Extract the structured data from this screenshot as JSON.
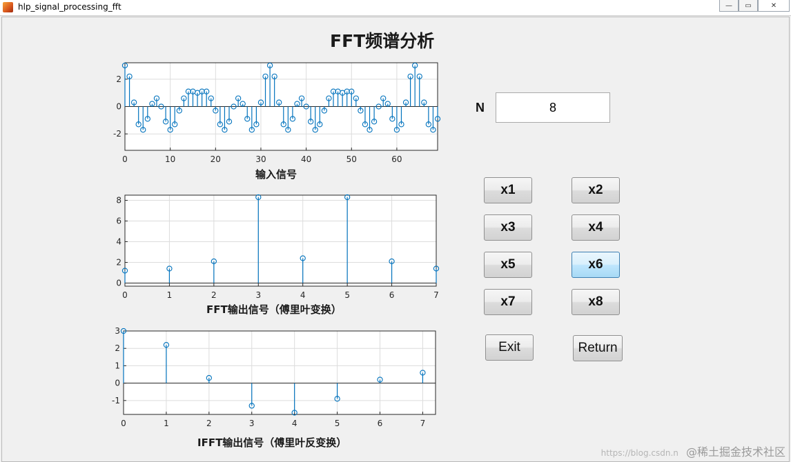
{
  "window": {
    "title": "hlp_signal_processing_fft",
    "controls": {
      "minimize": "—",
      "maximize": "▭",
      "close": "✕"
    }
  },
  "page_title": "FFT频谱分析",
  "n_field": {
    "label": "N",
    "value": "8"
  },
  "buttons": {
    "x1": "x1",
    "x2": "x2",
    "x3": "x3",
    "x4": "x4",
    "x5": "x5",
    "x6": "x6",
    "x7": "x7",
    "x8": "x8",
    "exit": "Exit",
    "return": "Return",
    "active": "x6"
  },
  "colors": {
    "stem": "#0072bd",
    "axes": "#262626",
    "grid": "#dcdcdc"
  },
  "watermark": {
    "url": "https://blog.csdn.n",
    "brand": "@稀土掘金技术社区"
  },
  "chart_data": [
    {
      "type": "stem",
      "caption": "输入信号",
      "xlim": [
        0,
        69
      ],
      "ylim": [
        -3.2,
        3.2
      ],
      "xticks": [
        0,
        10,
        20,
        30,
        40,
        50,
        60
      ],
      "yticks": [
        -2,
        0,
        2
      ],
      "x_start": 0,
      "values": [
        3.0,
        2.2,
        0.3,
        -1.3,
        -1.7,
        -0.9,
        0.2,
        0.6,
        0.0,
        -1.1,
        -1.7,
        -1.3,
        -0.3,
        0.6,
        1.1,
        1.1,
        1.0,
        1.1,
        1.1,
        0.6,
        -0.3,
        -1.3,
        -1.7,
        -1.1,
        0.0,
        0.6,
        0.2,
        -0.9,
        -1.7,
        -1.3,
        0.3,
        2.2,
        3.0,
        2.2,
        0.3,
        -1.3,
        -1.7,
        -0.9,
        0.2,
        0.6,
        0.0,
        -1.1,
        -1.7,
        -1.3,
        -0.3,
        0.6,
        1.1,
        1.1,
        1.0,
        1.1,
        1.1,
        0.6,
        -0.3,
        -1.3,
        -1.7,
        -1.1,
        0.0,
        0.6,
        0.2,
        -0.9,
        -1.7,
        -1.3,
        0.3,
        2.2,
        3.0,
        2.2,
        0.3,
        -1.3,
        -1.7,
        -0.9
      ]
    },
    {
      "type": "stem",
      "caption": "FFT输出信号（傅里叶变换）",
      "xlim": [
        0,
        7
      ],
      "ylim": [
        -0.3,
        8.5
      ],
      "xticks": [
        0,
        1,
        2,
        3,
        4,
        5,
        6,
        7
      ],
      "yticks": [
        0,
        2,
        4,
        6,
        8
      ],
      "x_start": 0,
      "values": [
        1.2,
        1.4,
        2.1,
        8.3,
        2.4,
        8.3,
        2.1,
        1.4
      ]
    },
    {
      "type": "stem",
      "caption": "IFFT输出信号（傅里叶反变换）",
      "xlim": [
        0,
        7.3
      ],
      "ylim": [
        -1.8,
        3.0
      ],
      "xticks": [
        0,
        1,
        2,
        3,
        4,
        5,
        6,
        7
      ],
      "yticks": [
        -1,
        0,
        1,
        2,
        3
      ],
      "x_start": 0,
      "values": [
        3.0,
        2.2,
        0.3,
        -1.3,
        -1.7,
        -0.9,
        0.2,
        0.6
      ]
    }
  ]
}
